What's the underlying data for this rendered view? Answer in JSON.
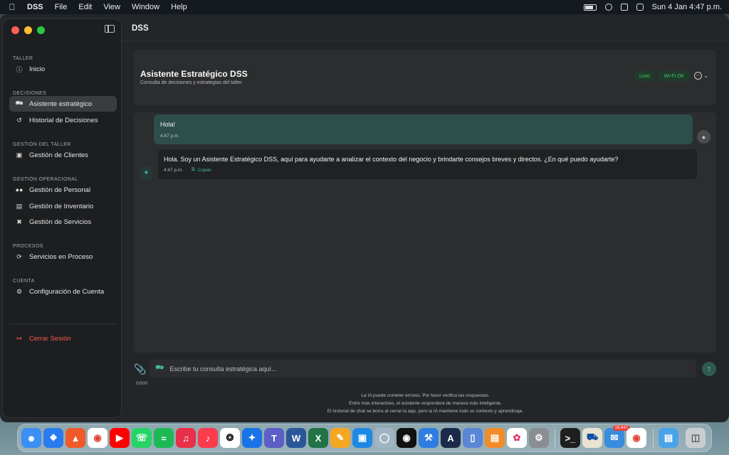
{
  "menubar": {
    "app_name": "DSS",
    "menus": [
      "File",
      "Edit",
      "View",
      "Window",
      "Help"
    ],
    "clock": "Sun 4 Jan  4:47 p.m."
  },
  "window": {
    "title": "DSS"
  },
  "sidebar": {
    "sections": [
      {
        "label": "TALLER",
        "items": [
          {
            "label": "Inicio",
            "icon": "info-icon"
          }
        ]
      },
      {
        "label": "DECISIONES",
        "items": [
          {
            "label": "Asistente estratégico",
            "icon": "chat-bubbles-icon",
            "active": true
          },
          {
            "label": "Historial de Decisiones",
            "icon": "history-icon"
          }
        ]
      },
      {
        "label": "GESTIÓN DEL TALLER",
        "items": [
          {
            "label": "Gestión de Clientes",
            "icon": "person-badge-icon"
          }
        ]
      },
      {
        "label": "GESTIÓN OPERACIONAL",
        "items": [
          {
            "label": "Gestión de Personal",
            "icon": "people-icon"
          },
          {
            "label": "Gestión de Inventario",
            "icon": "box-icon"
          },
          {
            "label": "Gestión de Servicios",
            "icon": "tools-icon"
          }
        ]
      },
      {
        "label": "PROCESOS",
        "items": [
          {
            "label": "Servicios en Proceso",
            "icon": "refresh-icon"
          }
        ]
      },
      {
        "label": "CUENTA",
        "items": [
          {
            "label": "Configuración de Cuenta",
            "icon": "gear-icon"
          }
        ]
      }
    ],
    "logout": "Cerrar Sesión"
  },
  "header": {
    "title": "Asistente Estratégico DSS",
    "subtitle": "Consulta de decisiones y estrategias del taller.",
    "badges": [
      "Listo",
      "Wi-Fi OK"
    ]
  },
  "chat": {
    "messages": [
      {
        "role": "user",
        "text": "Hola!",
        "time": "4:47 p.m."
      },
      {
        "role": "assistant",
        "text": "Hola. Soy un Asistente Estratégico DSS, aquí para ayudarte a analizar el contexto del negocio y brindarte consejos breves y directos. ¿En qué puedo ayudarte?",
        "time": "4:47 p.m.",
        "copy_label": "Copiar"
      }
    ]
  },
  "composer": {
    "placeholder": "Escribe tu consulta estratégica aquí...",
    "counter": "0/500"
  },
  "disclaimer": [
    "La IA puede cometer errores. Por favor verifica las respuestas.",
    "Entre más interactúes, el asistente responderá de manera más inteligente.",
    "El historial de chat se borra al cerrar la app, pero la IA mantiene todo su contexto y aprendizaje."
  ],
  "dock": {
    "mail_badge": "18,947"
  },
  "colors": {
    "accent": "#46b8a0",
    "user_bubble": "#2d4e4a",
    "logout": "#ff5a4e",
    "badge_green": "#47c46f"
  }
}
